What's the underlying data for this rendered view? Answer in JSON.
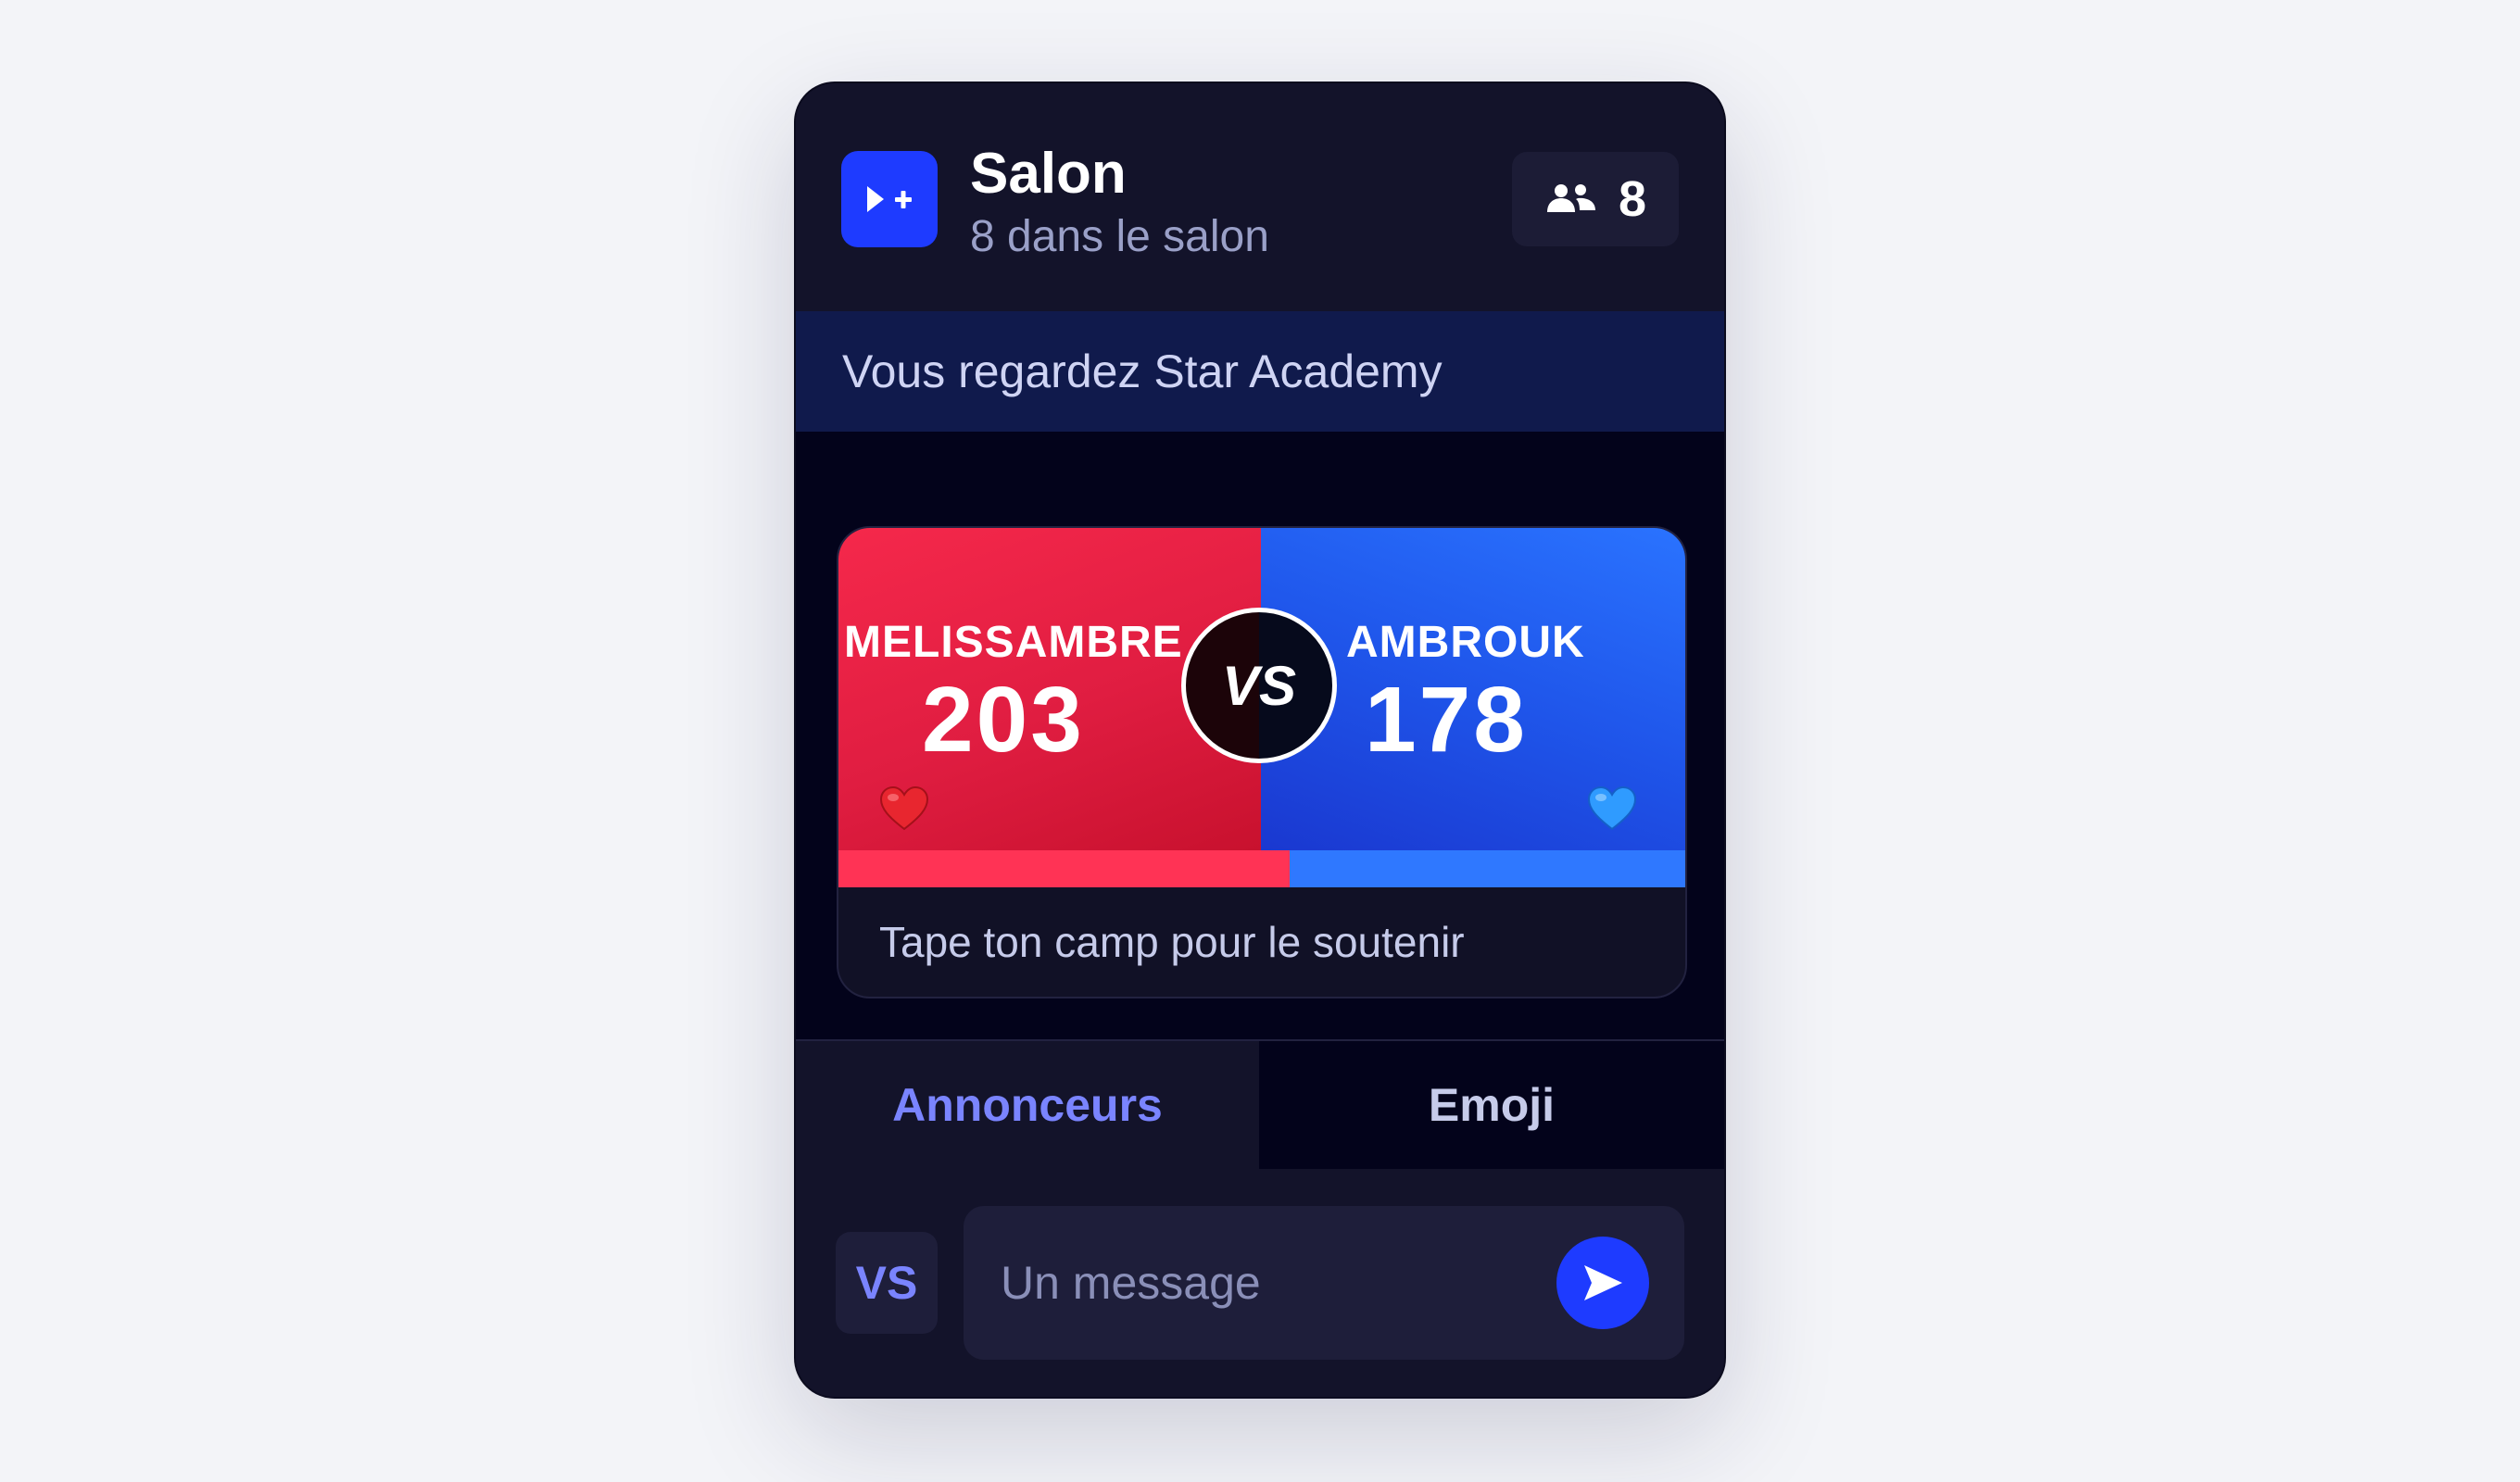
{
  "header": {
    "title": "Salon",
    "subtitle": "8 dans le salon",
    "logo_icon": "play-plus-icon",
    "member_count": "8",
    "member_icon": "users-icon"
  },
  "banner": {
    "text": "Vous regardez Star Academy"
  },
  "battle": {
    "left": {
      "name": "MELISSAMBRE",
      "score": "203",
      "emoji": "heart-red",
      "color": "#f5284b"
    },
    "right": {
      "name": "AMBROUK",
      "score": "178",
      "emoji": "heart-blue",
      "color": "#2a73ff"
    },
    "vs_label": "VS",
    "footer": "Tape ton camp pour le soutenir"
  },
  "tabs": [
    {
      "label": "Annonceurs",
      "active": true
    },
    {
      "label": "Emoji",
      "active": false
    }
  ],
  "composer": {
    "vs_button": "VS",
    "placeholder": "Un message",
    "send_icon": "send-icon"
  },
  "colors": {
    "accent": "#1e3bff",
    "tab_active": "#7a84ff"
  }
}
